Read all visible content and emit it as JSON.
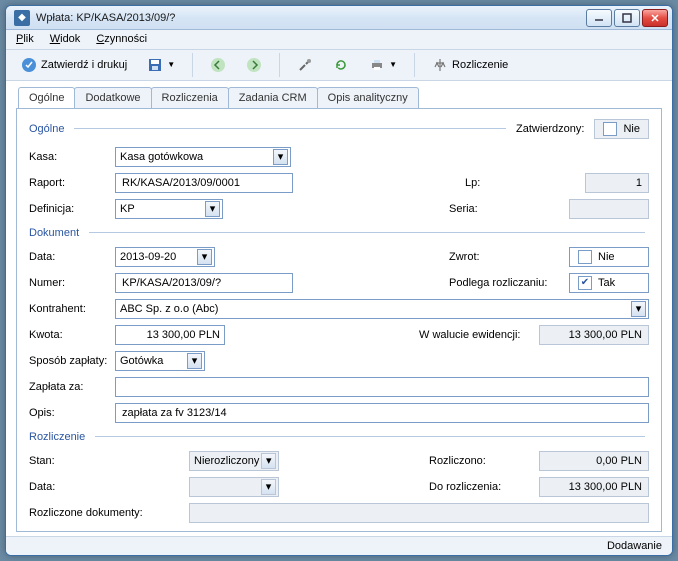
{
  "window": {
    "title": "Wpłata: KP/KASA/2013/09/?"
  },
  "menu": {
    "plik": "Plik",
    "widok": "Widok",
    "czynnosci": "Czynności"
  },
  "toolbar": {
    "zatwierdz": "Zatwierdź i drukuj",
    "rozliczenie": "Rozliczenie"
  },
  "tabs": {
    "ogolne": "Ogólne",
    "dodatkowe": "Dodatkowe",
    "rozliczenia": "Rozliczenia",
    "zadania": "Zadania CRM",
    "opis": "Opis analityczny"
  },
  "groups": {
    "ogolne": "Ogólne",
    "dokument": "Dokument",
    "rozliczenie": "Rozliczenie"
  },
  "labels": {
    "zatwierdzony": "Zatwierdzony:",
    "kasa": "Kasa:",
    "raport": "Raport:",
    "definicja": "Definicja:",
    "lp": "Lp:",
    "seria": "Seria:",
    "data": "Data:",
    "numer": "Numer:",
    "kontrahent": "Kontrahent:",
    "kwota": "Kwota:",
    "zwrot": "Zwrot:",
    "podlega": "Podlega rozliczaniu:",
    "wwalucie": "W walucie ewidencji:",
    "sposob": "Sposób zapłaty:",
    "zaplataza": "Zapłata za:",
    "opis": "Opis:",
    "stan": "Stan:",
    "rozliczono": "Rozliczono:",
    "dorozliczenia": "Do rozliczenia:",
    "rozlicdok": "Rozliczone dokumenty:",
    "nie": "Nie",
    "tak": "Tak"
  },
  "values": {
    "kasa": "Kasa gotówkowa",
    "raport": "RK/KASA/2013/09/0001",
    "definicja": "KP",
    "lp": "1",
    "seria": "",
    "data": "2013-09-20",
    "numer": "KP/KASA/2013/09/?",
    "kontrahent": "ABC Sp. z o.o (Abc)",
    "kwota": "13 300,00 PLN",
    "wwalucie": "13 300,00 PLN",
    "sposob": "Gotówka",
    "zaplataza": "",
    "opis": "zapłata za fv 3123/14",
    "stan": "Nierozliczony",
    "rozliczono": "0,00 PLN",
    "dorozliczenia": "13 300,00 PLN",
    "rozlicdok": ""
  },
  "status": {
    "text": "Dodawanie"
  }
}
